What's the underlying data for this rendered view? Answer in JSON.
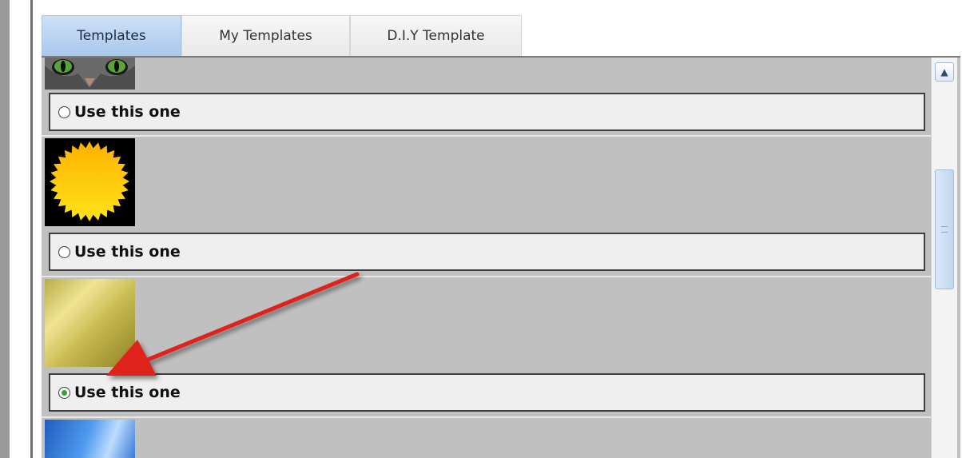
{
  "tabs": [
    {
      "label": "Templates",
      "active": true
    },
    {
      "label": "My Templates",
      "active": false
    },
    {
      "label": "D.I.Y Template",
      "active": false
    }
  ],
  "templates": [
    {
      "thumbnail": "cat-eyes-image",
      "option_label": "Use this one",
      "selected": false
    },
    {
      "thumbnail": "sun-burst-image",
      "option_label": "Use this one",
      "selected": false
    },
    {
      "thumbnail": "gold-gradient-image",
      "option_label": "Use this one",
      "selected": true
    },
    {
      "thumbnail": "blue-wave-image"
    }
  ],
  "scrollbar": {
    "up_icon": "chevron-up-icon"
  },
  "annotation": {
    "type": "arrow",
    "color": "#e0201a",
    "points_to": "template-3-option"
  },
  "colors": {
    "panel_bg": "#c0c0c0",
    "active_tab": "#a9c8ec",
    "selected_radio": "#2ea52e"
  }
}
